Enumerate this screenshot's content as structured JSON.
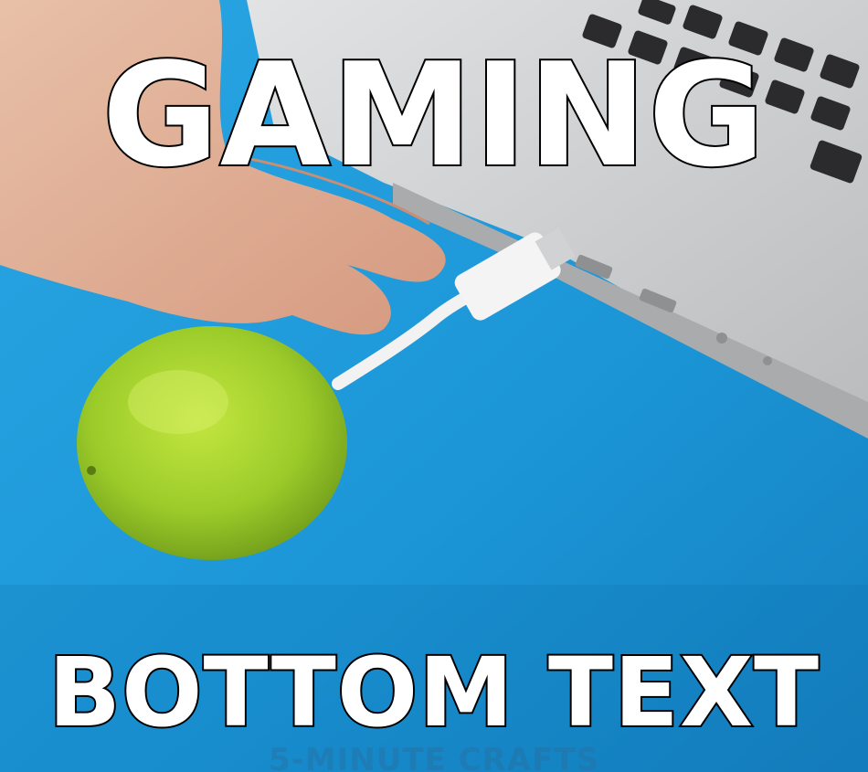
{
  "meme": {
    "top_text": "GAMING",
    "bottom_text": "BOTTOM TEXT",
    "watermark": "5-MINUTE CRAFTS"
  },
  "colors": {
    "background_blue": "#1e9ad8",
    "laptop_silver": "#c8cacc",
    "lime_green": "#9ccc2a",
    "cable_white": "#f2f2f2",
    "caption_fill": "#ffffff",
    "caption_outline": "#000000"
  }
}
